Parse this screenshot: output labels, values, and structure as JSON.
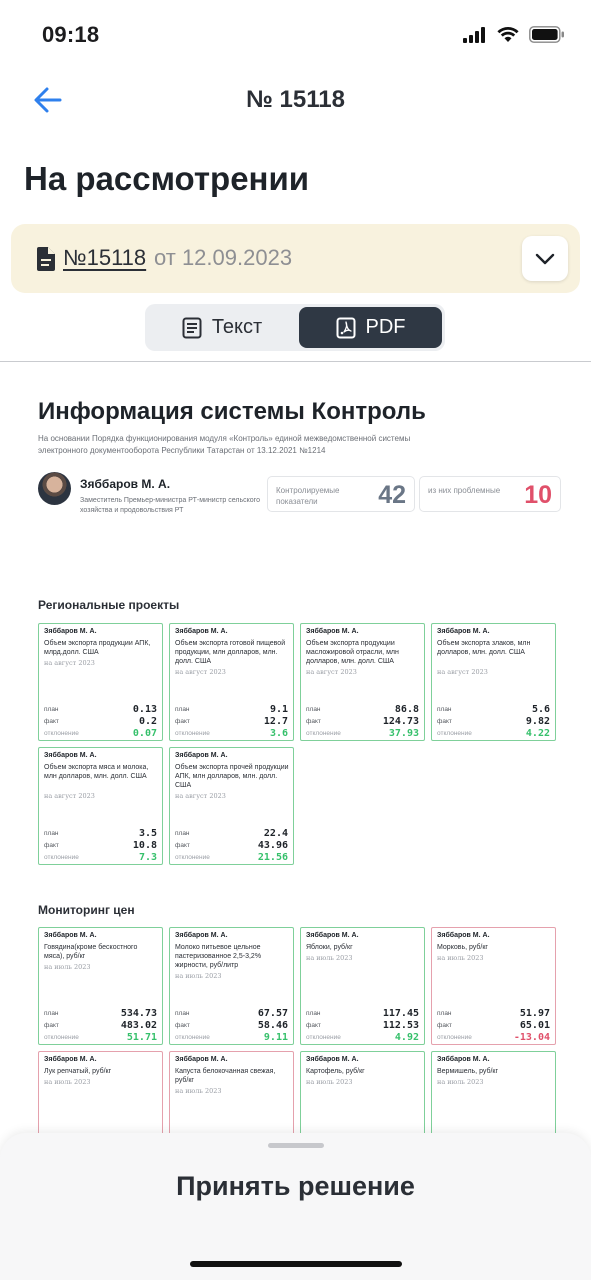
{
  "status": {
    "time": "09:18"
  },
  "nav": {
    "title": "№ 15118"
  },
  "page": {
    "heading": "На рассмотрении"
  },
  "doc": {
    "number": "№15118",
    "date": "от 12.09.2023"
  },
  "tabs": {
    "text_label": "Текст",
    "pdf_label": "PDF",
    "active": "PDF"
  },
  "pdf": {
    "title": "Информация системы Контроль",
    "subtitle": "На основании Порядка функционирования модуля «Контроль» единой межведомственной системы электронного документооборота Республики Татарстан от 13.12.2021 №1214",
    "person": {
      "name": "Зяббаров М. А.",
      "role": "Заместитель Премьер-министра РТ-министр сельского хозяйства и продовольствия РТ"
    },
    "kpi_controlled": {
      "label": "Контролируемые показатели",
      "value": "42"
    },
    "kpi_problem": {
      "label": "из них проблемные",
      "value": "10"
    },
    "labels": {
      "plan": "план",
      "fact": "факт",
      "dev": "отклонение"
    },
    "regional": {
      "title": "Региональные проекты",
      "cards": [
        {
          "name": "Зяббаров М. А.",
          "desc": "Объем экспорта продукции АПК, млрд.долл. США",
          "period": "на август 2023",
          "plan": "0.13",
          "fact": "0.2",
          "dev": "0.07",
          "status": "positive"
        },
        {
          "name": "Зяббаров М. А.",
          "desc": "Объем экспорта готовой пищевой продукции, млн долларов, млн. долл. США",
          "period": "на август 2023",
          "plan": "9.1",
          "fact": "12.7",
          "dev": "3.6",
          "status": "positive"
        },
        {
          "name": "Зяббаров М. А.",
          "desc": "Объем экспорта продукции масложировой отрасли, млн долларов, млн. долл. США",
          "period": "на август 2023",
          "plan": "86.8",
          "fact": "124.73",
          "dev": "37.93",
          "status": "positive"
        },
        {
          "name": "Зяббаров М. А.",
          "desc": "Объем экспорта злаков, млн долларов, млн. долл. США",
          "period": "на август 2023",
          "plan": "5.6",
          "fact": "9.82",
          "dev": "4.22",
          "status": "positive"
        },
        {
          "name": "Зяббаров М. А.",
          "desc": "Объем экспорта мяса и молока, млн долларов, млн. долл. США",
          "period": "на август 2023",
          "plan": "3.5",
          "fact": "10.8",
          "dev": "7.3",
          "status": "positive"
        },
        {
          "name": "Зяббаров М. А.",
          "desc": "Объем экспорта прочей продукции АПК, млн долларов, млн. долл. США",
          "period": "на август 2023",
          "plan": "22.4",
          "fact": "43.96",
          "dev": "21.56",
          "status": "positive"
        }
      ]
    },
    "prices": {
      "title": "Мониторинг цен",
      "cards": [
        {
          "name": "Зяббаров М. А.",
          "desc": "Говядина(кроме бескостного мяса), руб/кг",
          "period": "на июль 2023",
          "plan": "534.73",
          "fact": "483.02",
          "dev": "51.71",
          "status": "positive"
        },
        {
          "name": "Зяббаров М. А.",
          "desc": "Молоко питьевое цельное пастеризованное 2,5-3,2% жирности, руб/литр",
          "period": "на июль 2023",
          "plan": "67.57",
          "fact": "58.46",
          "dev": "9.11",
          "status": "positive"
        },
        {
          "name": "Зяббаров М. А.",
          "desc": "Яблоки, руб/кг",
          "period": "на июль 2023",
          "plan": "117.45",
          "fact": "112.53",
          "dev": "4.92",
          "status": "positive"
        },
        {
          "name": "Зяббаров М. А.",
          "desc": "Морковь, руб/кг",
          "period": "на июль 2023",
          "plan": "51.97",
          "fact": "65.01",
          "dev": "-13.04",
          "status": "negative"
        },
        {
          "name": "Зяббаров М. А.",
          "desc": "Лук репчатый, руб/кг",
          "period": "на июль 2023",
          "status": "negative"
        },
        {
          "name": "Зяббаров М. А.",
          "desc": "Капуста белокочанная свежая, руб/кг",
          "period": "на июль 2023",
          "status": "negative"
        },
        {
          "name": "Зяббаров М. А.",
          "desc": "Картофель, руб/кг",
          "period": "на июль 2023",
          "status": "positive"
        },
        {
          "name": "Зяббаров М. А.",
          "desc": "Вермишель, руб/кг",
          "period": "на июль 2023",
          "status": "positive"
        }
      ]
    }
  },
  "sheet": {
    "button_label": "Принять решение"
  },
  "colors": {
    "accent_blue": "#2f80ed",
    "positive": "#36c06b",
    "negative": "#e0506a",
    "doc_bar_bg": "#f8f2de",
    "tab_active_bg": "#2f3844"
  }
}
